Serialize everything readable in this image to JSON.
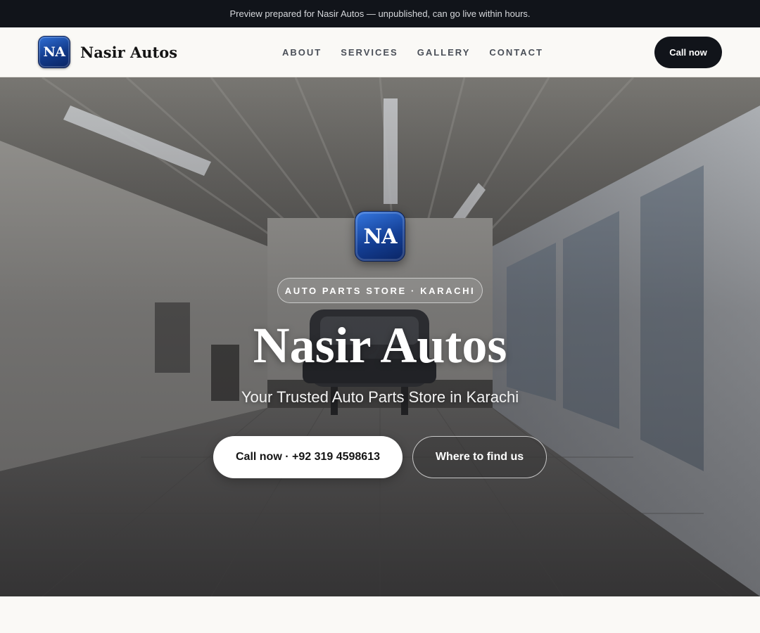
{
  "notice": {
    "text": "Preview prepared for Nasir Autos — unpublished, can go live within hours."
  },
  "header": {
    "logo_initials": "NA",
    "brand_name": "Nasir Autos",
    "nav": [
      {
        "label": "ABOUT"
      },
      {
        "label": "SERVICES"
      },
      {
        "label": "GALLERY"
      },
      {
        "label": "CONTACT"
      }
    ],
    "call_label": "Call now"
  },
  "hero": {
    "logo_initials": "NA",
    "tag": "AUTO PARTS STORE · KARACHI",
    "title": "Nasir Autos",
    "subtitle": "Your Trusted Auto Parts Store in Karachi",
    "call_button": "Call now · +92 319 4598613",
    "find_button": "Where to find us"
  },
  "colors": {
    "dark": "#11141a",
    "page_bg": "#faf9f6",
    "logo_blue": "#143f95"
  }
}
